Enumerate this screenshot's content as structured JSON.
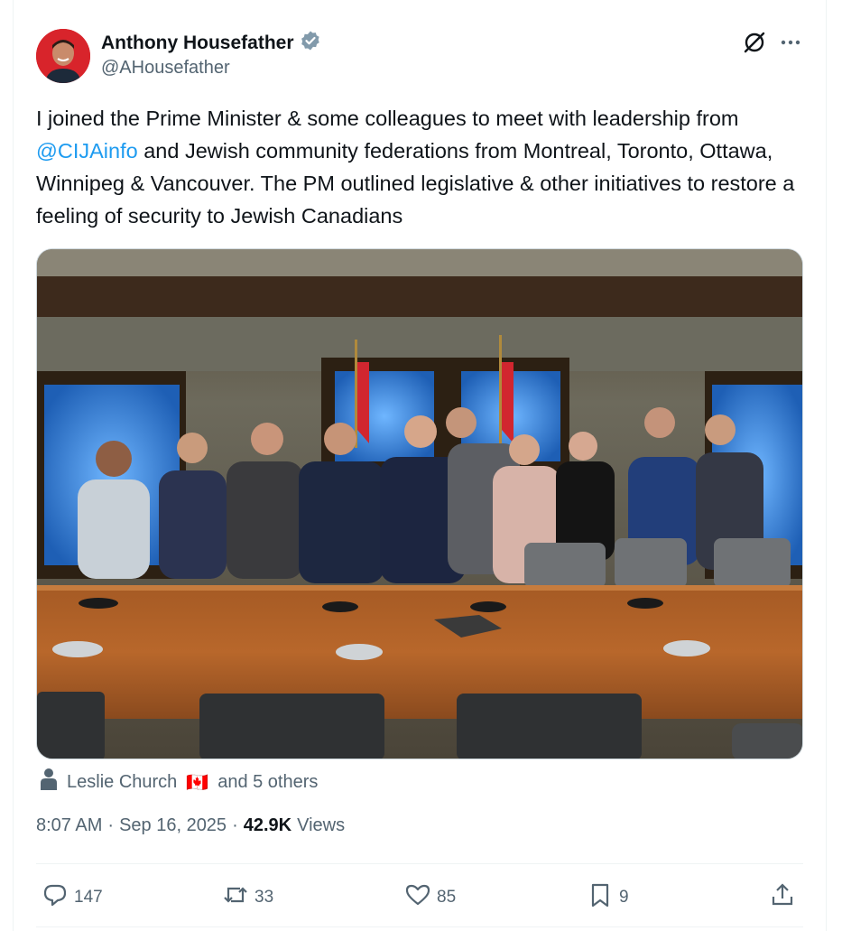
{
  "author": {
    "display_name": "Anthony Housefather",
    "handle": "@AHousefather",
    "verified": true
  },
  "tweet": {
    "text_part1": "I joined the Prime Minister & some colleagues to meet with leadership from ",
    "mention": "@CIJAinfo",
    "text_part2": " and Jewish community federations from Montreal, Toronto, Ottawa, Winnipeg & Vancouver. The PM outlined legislative & other initiatives to restore a feeling of security to Jewish Canadians"
  },
  "tagged": {
    "name": "Leslie Church",
    "flag": "🇨🇦",
    "others": "and 5 others"
  },
  "meta": {
    "time": "8:07 AM",
    "dot1": "·",
    "date": "Sep 16, 2025",
    "dot2": "·",
    "views_count": "42.9K",
    "views_label": "Views"
  },
  "actions": {
    "replies": "147",
    "reposts": "33",
    "likes": "85",
    "bookmarks": "9"
  },
  "colors": {
    "text": "#0f1419",
    "secondary": "#536471",
    "link": "#1d9bf0",
    "verified": "#829aab"
  },
  "icons": [
    "verified-badge-icon",
    "grok-icon",
    "more-icon",
    "person-icon",
    "reply-icon",
    "repost-icon",
    "like-icon",
    "bookmark-icon",
    "share-icon"
  ]
}
